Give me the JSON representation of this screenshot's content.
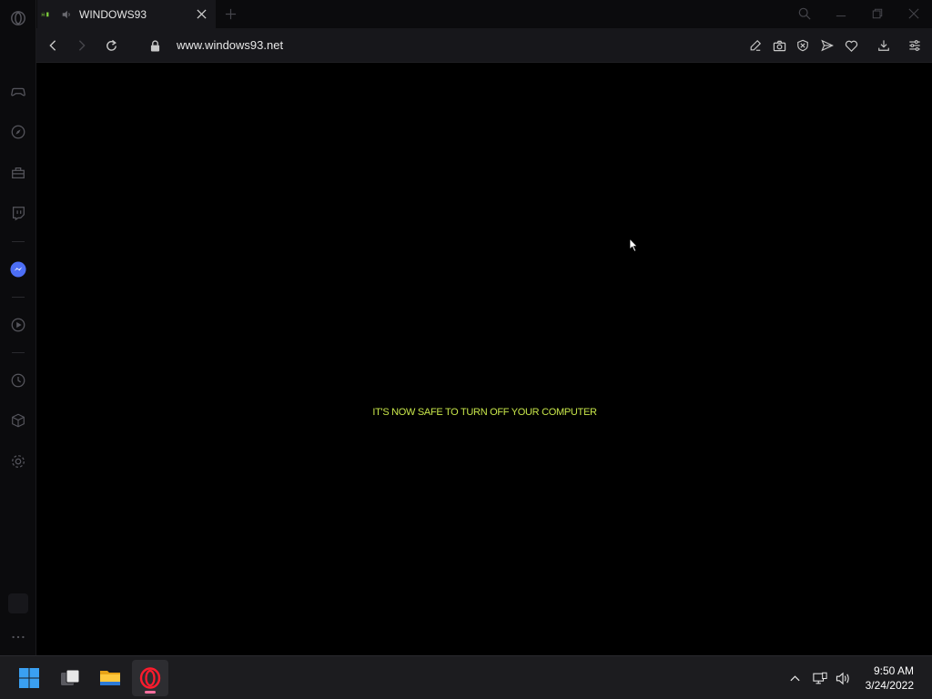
{
  "browser": {
    "tab": {
      "favicon_text": "☠▮",
      "title": "WINDOWS93"
    },
    "address": {
      "url": "www.windows93.net"
    },
    "sidebar_icons": [
      "opera-logo-icon",
      "gamepad-icon",
      "compass-icon",
      "ticket-icon",
      "twitch-icon",
      "messenger-icon",
      "play-icon",
      "history-icon",
      "cube-icon",
      "gear-icon",
      "more-icon"
    ],
    "toolbar_icons": [
      "edit-icon",
      "camera-icon",
      "shield-icon",
      "send-icon",
      "heart-icon",
      "download-icon",
      "easy-setup-icon"
    ]
  },
  "page": {
    "message": "IT'S NOW SAFE TO TURN OFF YOUR COMPUTER",
    "message_color": "#c8e64a"
  },
  "taskbar": {
    "apps": [
      "windows-start-icon",
      "task-view-icon",
      "file-explorer-icon",
      "opera-icon"
    ],
    "time": "9:50 AM",
    "date": "3/24/2022"
  },
  "colors": {
    "accent_messenger": "#4c6ef5",
    "opera_red": "#ff1b2d",
    "active_indicator": "#ff6fa0"
  }
}
